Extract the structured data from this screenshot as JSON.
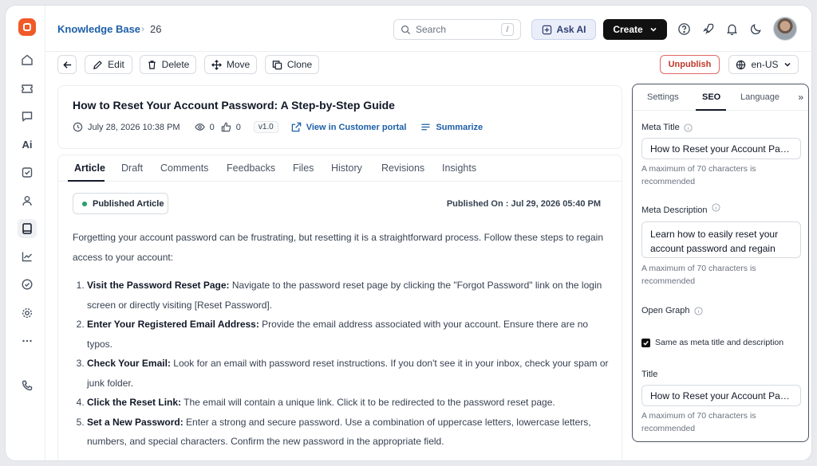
{
  "breadcrumb": {
    "root": "Knowledge Base",
    "current": "26"
  },
  "topbar": {
    "search_placeholder": "Search",
    "search_shortcut": "/",
    "ask_ai_label": "Ask AI",
    "create_label": "Create"
  },
  "rail": {
    "ai_label": "Ai"
  },
  "toolbar": {
    "edit_label": "Edit",
    "delete_label": "Delete",
    "move_label": "Move",
    "clone_label": "Clone",
    "unpublish_label": "Unpublish",
    "language": "en-US"
  },
  "article": {
    "title": "How to Reset Your Account Password: A Step-by-Step Guide",
    "date": "July 28, 2026 10:38 PM",
    "views": "0",
    "likes": "0",
    "version": "v1.0",
    "portal_link": "View in Customer portal",
    "summarize_label": "Summarize"
  },
  "tabs": [
    "Article",
    "Draft",
    "Comments",
    "Feedbacks",
    "Files",
    "History",
    "Revisions",
    "Insights"
  ],
  "status_badge": "Published Article",
  "published_on": "Published On : Jul 29, 2026 05:40 PM",
  "content": {
    "intro": "Forgetting your account password can be frustrating, but resetting it is a straightforward process. Follow these steps to regain access to your account:",
    "steps": [
      {
        "title": "Visit the Password Reset Page:",
        "text": " Navigate to the password reset page by clicking the \"Forgot Password\" link on the login screen or directly visiting [Reset Password]."
      },
      {
        "title": "Enter Your Registered Email Address:",
        "text": " Provide the email address associated with your account. Ensure there are no typos."
      },
      {
        "title": "Check Your Email:",
        "text": " Look for an email with password reset instructions. If you don't see it in your inbox, check your spam or junk folder."
      },
      {
        "title": "Click the Reset Link:",
        "text": " The email will contain a unique link. Click it to be redirected to the password reset page."
      },
      {
        "title": "Set a New Password:",
        "text": " Enter a strong and secure password. Use a combination of uppercase letters, lowercase letters, numbers, and special characters. Confirm the new password in the appropriate field."
      }
    ]
  },
  "seo_panel": {
    "tabs": [
      "Settings",
      "SEO",
      "Language"
    ],
    "expand_glyph": "»",
    "meta_title_label": "Meta Title",
    "meta_title_value": "How to Reset your Account Password",
    "meta_title_hint": "A maximum of 70 characters is recommended",
    "meta_description_label": "Meta Description",
    "meta_description_value": "Learn how to easily reset your account password and regain access",
    "meta_description_hint": "A maximum of 70 characters is recommended",
    "open_graph_label": "Open Graph",
    "same_as_label": "Same as meta title and description",
    "same_as_checked": true,
    "og_title_label": "Title",
    "og_title_value": "How to Reset your Account Password",
    "og_title_hint": "A maximum of 70 characters is recommended"
  }
}
